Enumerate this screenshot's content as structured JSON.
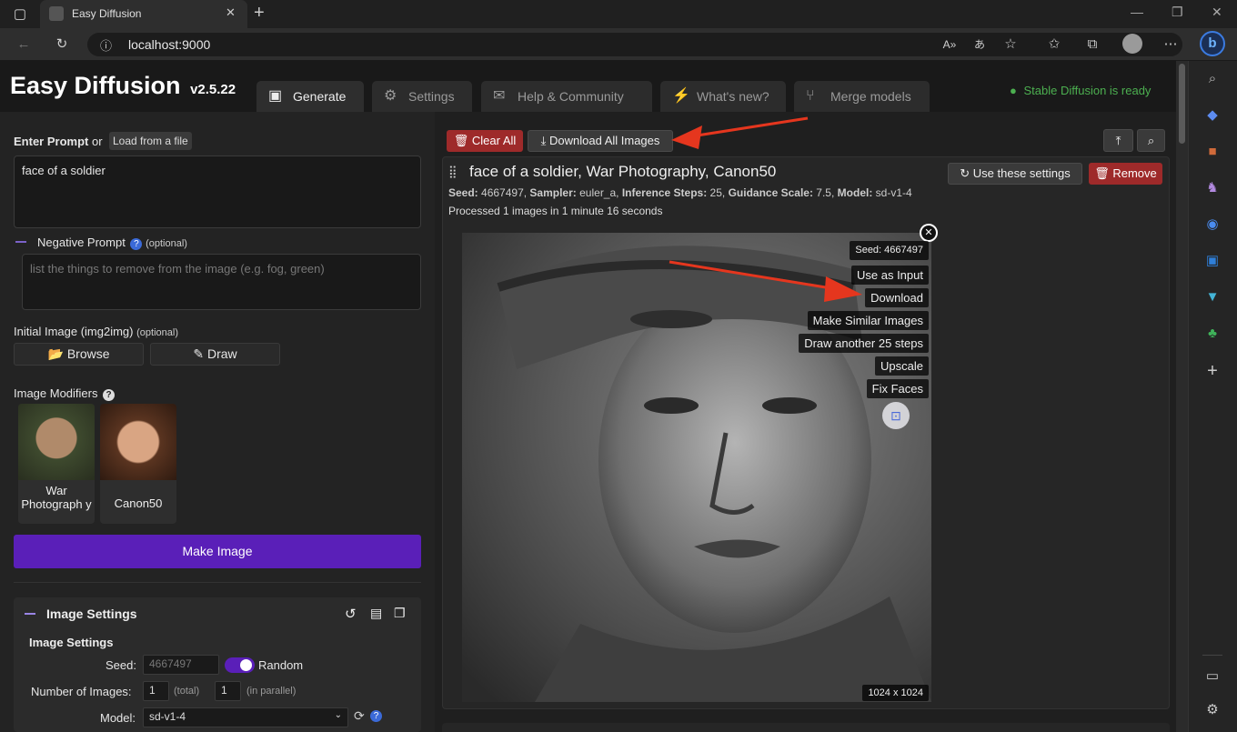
{
  "browser": {
    "tab_title": "Easy Diffusion",
    "url": "localhost:9000",
    "icons": [
      "sidebar-toggle-icon",
      "tab-favicon",
      "close-tab-icon",
      "new-tab-icon",
      "back-icon",
      "reload-icon",
      "info-icon",
      "read-aloud-icon",
      "translate-icon",
      "favorite-star-icon",
      "favorites-icon",
      "collections-icon",
      "profile-icon",
      "more-icon",
      "bing-icon"
    ],
    "window_controls": [
      "—",
      "❐",
      "✕"
    ]
  },
  "app": {
    "title": "Easy Diffusion",
    "version": "v2.5.22",
    "status": "Stable Diffusion is ready",
    "status_color": "#4caf50",
    "accent": "#5a1fb8",
    "tabs": [
      {
        "label": "Generate",
        "icon": "image-icon"
      },
      {
        "label": "Settings",
        "icon": "gear-icon"
      },
      {
        "label": "Help & Community",
        "icon": "comments-icon"
      },
      {
        "label": "What's new?",
        "icon": "bolt-icon"
      },
      {
        "label": "Merge models",
        "icon": "merge-icon"
      }
    ]
  },
  "left": {
    "prompt_label": "Enter Prompt",
    "or": "or",
    "load_file": "Load from a file",
    "prompt_value": "face of a soldier",
    "negative_label": "Negative Prompt",
    "optional": "(optional)",
    "negative_placeholder": "list the things to remove from the image (e.g. fog, green)",
    "init_image_label": "Initial Image (img2img)",
    "browse": "Browse",
    "draw": "Draw",
    "modifiers_label": "Image Modifiers",
    "modifiers": [
      {
        "label": "War Photograph y"
      },
      {
        "label": "Canon50"
      }
    ],
    "make_image": "Make Image",
    "settings": {
      "header": "Image Settings",
      "subheader": "Image Settings",
      "seed_label": "Seed:",
      "seed_value": "4667497",
      "random_label": "Random",
      "num_images_label": "Number of Images:",
      "num_total": "1",
      "total": "(total)",
      "num_parallel": "1",
      "parallel": "(in parallel)",
      "model_label": "Model:",
      "model_value": "sd-v1-4"
    }
  },
  "right": {
    "clear_all": "Clear All",
    "download_all": "Download All Images",
    "task_title": "face of a soldier, War Photography, Canon50",
    "use_settings": "Use these settings",
    "remove": "Remove",
    "meta": {
      "seed_k": "Seed:",
      "seed_v": "4667497",
      "sampler_k": "Sampler:",
      "sampler_v": "euler_a",
      "steps_k": "Inference Steps:",
      "steps_v": "25",
      "guidance_k": "Guidance Scale:",
      "guidance_v": "7.5",
      "model_k": "Model:",
      "model_v": "sd-v1-4"
    },
    "processed": "Processed 1 images in 1 minute 16 seconds",
    "overlay": {
      "seed": "Seed: 4667497",
      "use_as_input": "Use as Input",
      "download": "Download",
      "make_similar": "Make Similar Images",
      "draw_another": "Draw another 25 steps",
      "upscale": "Upscale",
      "fix_faces": "Fix Faces",
      "size": "1024 x 1024"
    }
  }
}
